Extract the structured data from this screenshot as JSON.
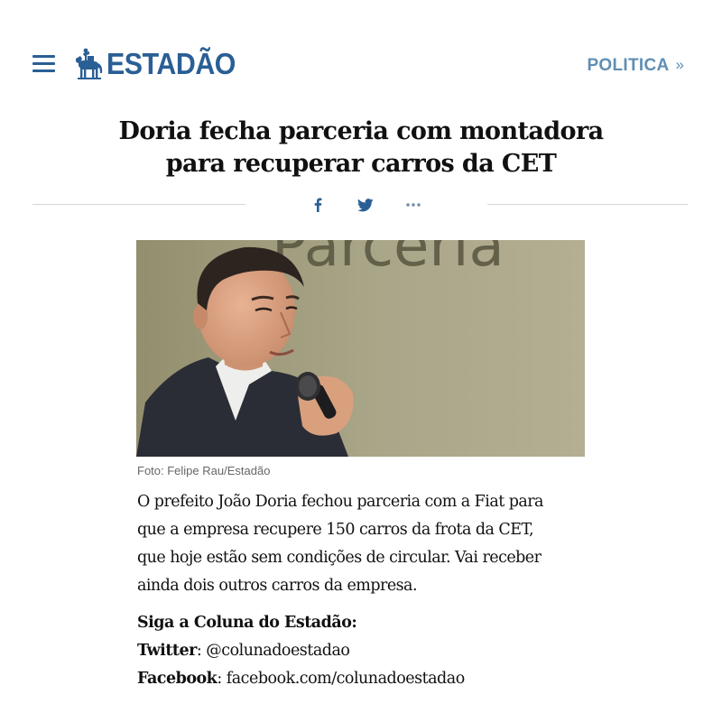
{
  "header": {
    "logo_text": "ESTADÃO",
    "logo_icon": "knight-horse-icon",
    "menu_icon": "hamburger-menu-icon",
    "section_label": "POLITICA",
    "section_chevron": "»"
  },
  "article": {
    "headline_line1": "Doria fecha parceria com montadora",
    "headline_line2": "para recuperar carros da CET",
    "share": {
      "facebook_icon": "facebook-icon",
      "twitter_icon": "twitter-icon",
      "more_icon": "more-dots-icon"
    },
    "photo_caption": "Foto: Felipe Rau/Estadão",
    "photo_background_text": "Parceria",
    "body_lines": [
      "O prefeito João Doria fechou parceria com a Fiat para",
      "que a empresa recupere 150 carros da frota da CET,",
      "que hoje estão sem condições de circular. Vai receber",
      "ainda dois outros carros da empresa."
    ],
    "follow_title": "Siga a Coluna do Estadão:",
    "twitter_label": "Twitter",
    "twitter_value": ": @colunadoestadao",
    "facebook_label": "Facebook",
    "facebook_value": ": facebook.com/colunadoestadao"
  },
  "colors": {
    "brand_blue": "#2a5f95",
    "section_blue": "#5f8fb5",
    "headline": "#111111",
    "caption": "#666666",
    "rule": "#d5d5d5"
  }
}
